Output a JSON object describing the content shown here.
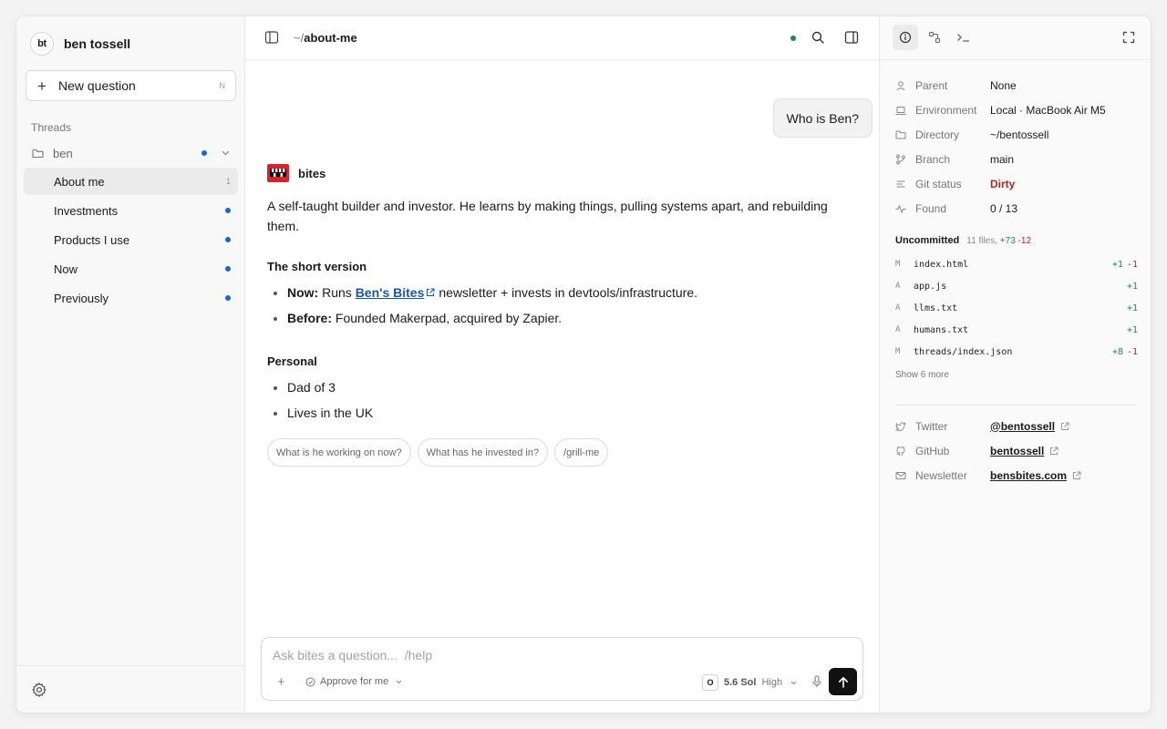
{
  "sidebar": {
    "avatar_initials": "bt",
    "user_name": "ben tossell",
    "new_question": {
      "label": "New question",
      "shortcut": "N"
    },
    "section_label": "Threads",
    "folder": {
      "name": "ben"
    },
    "threads": [
      {
        "name": "About me",
        "count": "1",
        "active": true
      },
      {
        "name": "Investments",
        "unread": true
      },
      {
        "name": "Products I use",
        "unread": true
      },
      {
        "name": "Now",
        "unread": true
      },
      {
        "name": "Previously",
        "unread": true
      }
    ]
  },
  "header": {
    "path_prefix": "~/",
    "path_dir": "about-me",
    "status_color": "#1c8a4c"
  },
  "conversation": {
    "user_message": "Who is Ben?",
    "bot_name": "bites",
    "intro": "A self-taught builder and investor. He learns by making things, pulling systems apart, and rebuilding them.",
    "section1_title": "The short version",
    "now_label": "Now:",
    "now_pre": "Runs",
    "now_link": "Ben's Bites",
    "now_post": "newsletter + invests in devtools/infrastructure.",
    "before_label": "Before:",
    "before_text": "Founded Makerpad, acquired by Zapier.",
    "section2_title": "Personal",
    "personal": [
      "Dad of 3",
      "Lives in the UK"
    ],
    "suggestions": [
      "What is he working on now?",
      "What has he invested in?",
      "/grill-me"
    ]
  },
  "composer": {
    "placeholder": "Ask bites a question...  /help",
    "approve_label": "Approve for me",
    "model_badge": "O",
    "model_name": "5.6 Sol",
    "effort": "High"
  },
  "panel": {
    "props": [
      {
        "key": "Parent",
        "value": "None",
        "icon": "person-icon"
      },
      {
        "key": "Environment",
        "value": "Local · MacBook Air M5",
        "icon": "laptop-icon"
      },
      {
        "key": "Directory",
        "value": "~/bentossell",
        "icon": "folder-icon"
      },
      {
        "key": "Branch",
        "value": "main",
        "icon": "branch-icon"
      },
      {
        "key": "Git status",
        "value": "Dirty",
        "icon": "lines-icon"
      },
      {
        "key": "Found",
        "value": "0 / 13",
        "icon": "pulse-icon"
      }
    ],
    "uncommitted_title": "Uncommitted",
    "uncommitted_summary": {
      "files": "11 files,",
      "add": "+73",
      "del": "-12"
    },
    "files": [
      {
        "status": "M",
        "name": "index.html",
        "add": "+1",
        "del": "-1"
      },
      {
        "status": "A",
        "name": "app.js",
        "add": "+1",
        "del": ""
      },
      {
        "status": "A",
        "name": "llms.txt",
        "add": "+1",
        "del": ""
      },
      {
        "status": "A",
        "name": "humans.txt",
        "add": "+1",
        "del": ""
      },
      {
        "status": "M",
        "name": "threads/index.json",
        "add": "+8",
        "del": "-1"
      }
    ],
    "show_more": "Show 6 more",
    "links": [
      {
        "key": "Twitter",
        "value": "@bentossell",
        "icon": "twitter-icon"
      },
      {
        "key": "GitHub",
        "value": "bentossell",
        "icon": "github-icon"
      },
      {
        "key": "Newsletter",
        "value": "bensbites.com",
        "icon": "mail-icon"
      }
    ]
  },
  "colors": {
    "accent_blue": "#1a66cc",
    "link_blue": "#1a56a8",
    "dirty_red": "#b3261e",
    "add_green": "#1c8a4c"
  }
}
